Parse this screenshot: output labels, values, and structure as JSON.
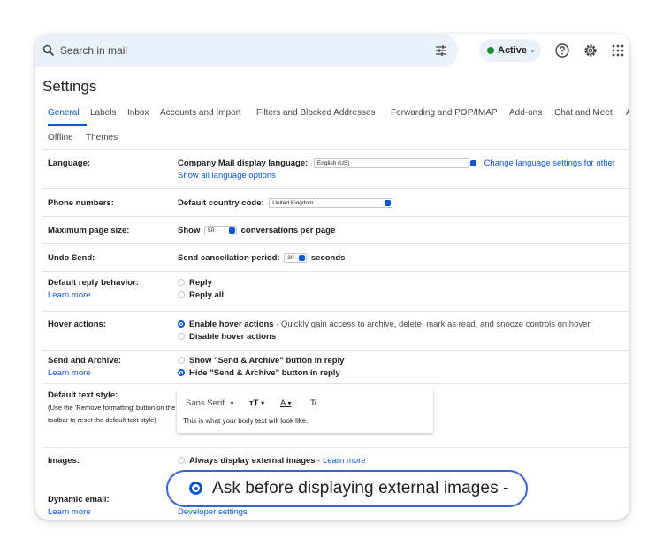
{
  "search": {
    "placeholder": "Search in mail"
  },
  "status": {
    "label": "Active",
    "chevron": "⌄",
    "dot_color": "#1e8e3e"
  },
  "icons": [
    "search-icon",
    "tune-icon",
    "help-icon",
    "gear-icon",
    "apps-grid-icon"
  ],
  "page_title": "Settings",
  "tabs": [
    {
      "label": "General",
      "active": true
    },
    {
      "label": "Labels"
    },
    {
      "label": "Inbox"
    },
    {
      "label": "Accounts and Import"
    },
    {
      "label": "Filters and Blocked Addresses"
    },
    {
      "label": "Forwarding and POP/IMAP"
    },
    {
      "label": "Add-ons"
    },
    {
      "label": "Chat and Meet"
    },
    {
      "label": "A"
    },
    {
      "label": "Offline"
    },
    {
      "label": "Themes"
    }
  ],
  "settings": {
    "language": {
      "label": "Language:",
      "display_label": "Company Mail display language:",
      "display_value": "English (US)",
      "change_link": "Change language settings for other",
      "show_all_link": "Show all language options"
    },
    "phone": {
      "label": "Phone numbers:",
      "country_label": "Default country code:",
      "country_value": "United Kingdom"
    },
    "page_size": {
      "label": "Maximum page size:",
      "prefix": "Show",
      "value": "50",
      "suffix": "conversations per page"
    },
    "undo_send": {
      "label": "Undo Send:",
      "prefix": "Send cancellation period:",
      "value": "30",
      "suffix": "seconds"
    },
    "reply": {
      "label": "Default reply behavior:",
      "learn_more": "Learn more",
      "options": [
        "Reply",
        "Reply all"
      ]
    },
    "hover": {
      "label": "Hover actions:",
      "enable": "Enable hover actions",
      "enable_desc": " - Quickly gain access to archive, delete, mark as read, and snooze controls on hover.",
      "disable": "Disable hover actions"
    },
    "send_archive": {
      "label": "Send and Archive:",
      "learn_more": "Learn more",
      "show": "Show \"Send & Archive\" button in reply",
      "hide": "Hide \"Send & Archive\" button in reply"
    },
    "text_style": {
      "label": "Default text style:",
      "note": "(Use the 'Remove formatting' button on the toolbar to reset the default text style)",
      "font": "Sans Serif",
      "dropdown_caret": "▾",
      "size_icon": "тT",
      "color_icon": "A",
      "clear_icon": "T̸",
      "preview": "This is what your body text will look like."
    },
    "images": {
      "label": "Images:",
      "always": "Always display external images",
      "always_sep": " - ",
      "learn_more": "Learn more"
    },
    "dynamic": {
      "label": "Dynamic email:",
      "learn_more": "Learn more",
      "developer": "Developer settings"
    }
  },
  "highlight": {
    "text": "Ask before displaying external images -"
  }
}
